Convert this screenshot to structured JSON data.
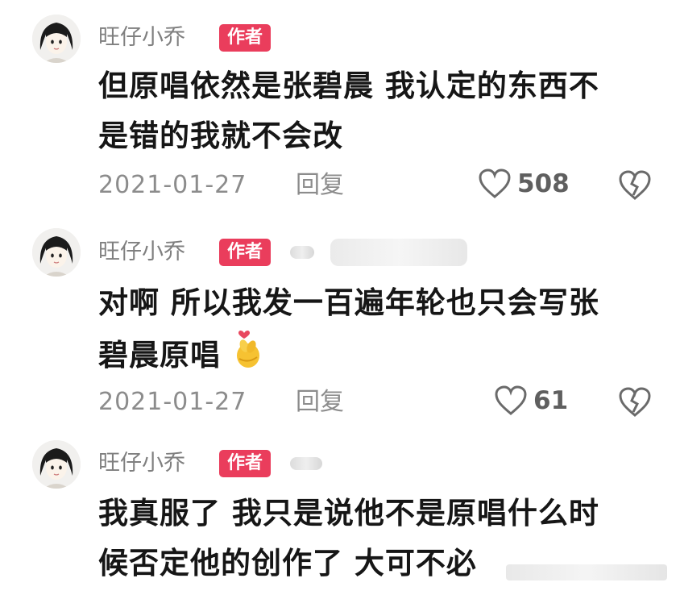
{
  "comments": [
    {
      "username": "旺仔小乔",
      "badge": "作者",
      "text_lines": [
        "但原唱依然是张碧晨 我认定的东西不",
        "是错的我就不会改"
      ],
      "date": "2021-01-27",
      "reply_label": "回复",
      "likes": "508"
    },
    {
      "username": "旺仔小乔",
      "badge": "作者",
      "text_lines": [
        "对啊 所以我发一百遍年轮也只会写张",
        "碧晨原唱"
      ],
      "date": "2021-01-27",
      "reply_label": "回复",
      "likes": "61"
    },
    {
      "username": "旺仔小乔",
      "badge": "作者",
      "text_lines": [
        "我真服了 我只是说他不是原唱什么时",
        "候否定他的创作了 大可不必"
      ]
    }
  ],
  "icons": {
    "like": "heart-outline-icon",
    "dislike": "broken-heart-icon",
    "emoji": "finger-heart-emoji"
  },
  "colors": {
    "badge_bg": "#ea3d5c",
    "text": "#161616",
    "meta": "#8c8c8c"
  }
}
